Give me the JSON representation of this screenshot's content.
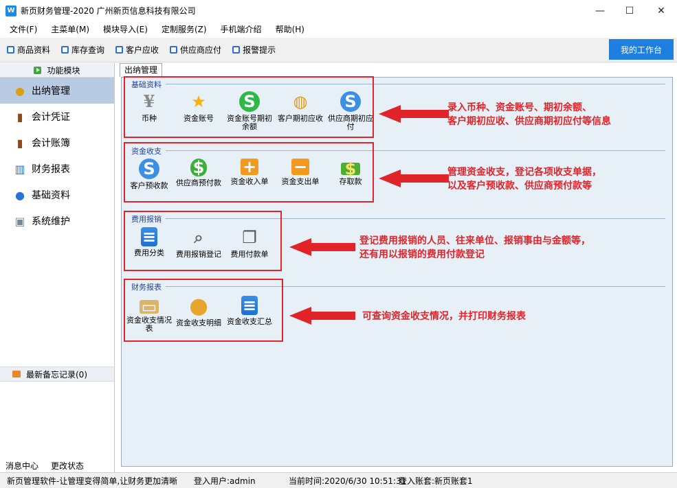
{
  "window": {
    "title": "新页财务管理-2020 广州新页信息科技有限公司",
    "logo": "W",
    "controls": {
      "minimize": "—",
      "maximize": "☐",
      "close": "✕"
    }
  },
  "menu": [
    "文件(F)",
    "主菜单(M)",
    "模块导入(E)",
    "定制服务(Z)",
    "手机端介绍",
    "帮助(H)"
  ],
  "toolbar": {
    "items": [
      "商品资料",
      "库存查询",
      "客户应收",
      "供应商应付",
      "报警提示"
    ],
    "workbench": "我的工作台"
  },
  "sidebar": {
    "header": "功能模块",
    "items": [
      {
        "label": "出纳管理",
        "icon": "coins-icon"
      },
      {
        "label": "会计凭证",
        "icon": "book-icon"
      },
      {
        "label": "会计账簿",
        "icon": "ledger-icon"
      },
      {
        "label": "财务报表",
        "icon": "bar-chart-icon"
      },
      {
        "label": "基础资料",
        "icon": "user-icon"
      },
      {
        "label": "系统维护",
        "icon": "lock-icon"
      }
    ],
    "memo": "最新备忘记录(0)",
    "footer": [
      "消息中心",
      "更改状态"
    ]
  },
  "main": {
    "tab": "出纳管理",
    "sections": [
      {
        "title": "基础资料",
        "tiles": [
          "币种",
          "资金账号",
          "资金账号期初余额",
          "客户期初应收",
          "供应商期初应付"
        ],
        "note": [
          "录入币种、资金账号、期初余额、",
          "客户期初应收、供应商期初应付等信息"
        ]
      },
      {
        "title": "资金收支",
        "tiles": [
          "客户预收款",
          "供应商预付款",
          "资金收入单",
          "资金支出单",
          "存取款"
        ],
        "note": [
          "管理资金收支，登记各项收支单据，",
          "以及客户预收款、供应商预付款等"
        ]
      },
      {
        "title": "费用报销",
        "tiles": [
          "费用分类",
          "费用报销登记",
          "费用付款单"
        ],
        "note": [
          "登记费用报销的人员、往来单位、报销事由与金额等，",
          "还有用以报销的费用付款登记"
        ]
      },
      {
        "title": "财务报表",
        "tiles": [
          "资金收支情况表",
          "资金收支明细",
          "资金收支汇总"
        ],
        "note": [
          "可查询资金收支情况，并打印财务报表"
        ]
      }
    ]
  },
  "status": {
    "slogan": "新页管理软件-让管理变得简单,让财务更加清晰",
    "user": "登入用户:admin",
    "time": "当前时间:2020/6/30 10:51:31",
    "account": "登入账套:新页账套1"
  }
}
